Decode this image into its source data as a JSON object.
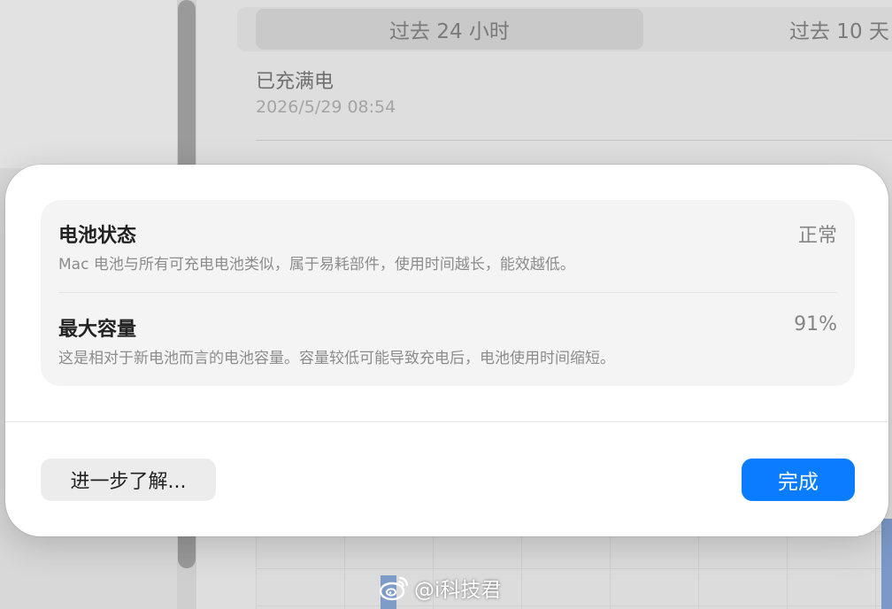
{
  "background": {
    "time_range": {
      "selected": "过去 24 小时",
      "other": "过去 10 天"
    },
    "charge_status": {
      "title": "已充满电",
      "timestamp": "2026/5/29 08:54"
    }
  },
  "dialog": {
    "rows": [
      {
        "title": "电池状态",
        "value": "正常",
        "description": "Mac 电池与所有可充电电池类似，属于易耗部件，使用时间越长，能效越低。"
      },
      {
        "title": "最大容量",
        "value": "91%",
        "description": "这是相对于新电池而言的电池容量。容量较低可能导致充电后，电池使用时间缩短。"
      }
    ],
    "learn_more_label": "进一步了解...",
    "done_label": "完成",
    "accent_color": "#0a7cff"
  },
  "watermark": {
    "icon": "weibo-icon",
    "text": "@i科技君"
  }
}
